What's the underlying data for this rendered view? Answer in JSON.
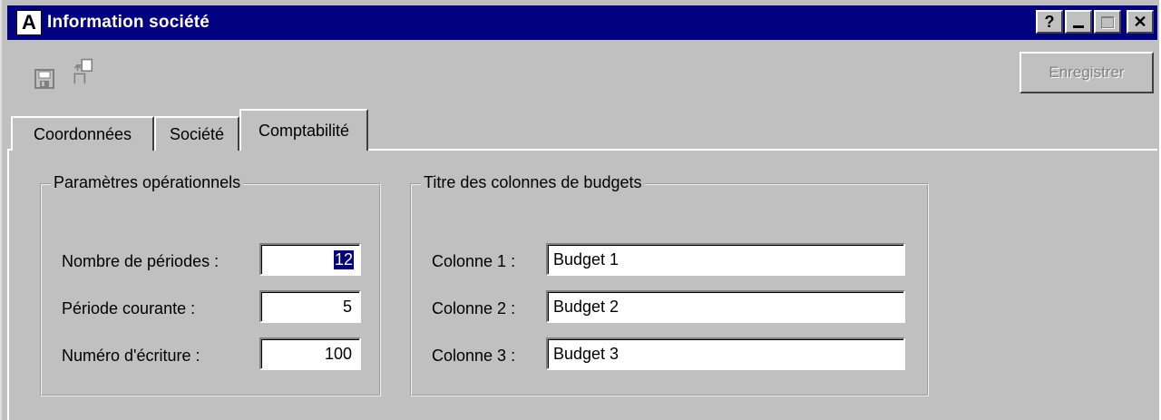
{
  "window": {
    "title": "Information société",
    "app_icon_letter": "A",
    "caption_buttons": [
      "?",
      "_",
      "□",
      "✕"
    ]
  },
  "toolbar": {
    "save_icon": "save-icon",
    "copy_icon": "copy-icon",
    "save_button_label": "Enregistrer"
  },
  "tabs": [
    {
      "label": "Coordonnées"
    },
    {
      "label": "Société"
    },
    {
      "label": "Comptabilité"
    }
  ],
  "operational": {
    "title": "Paramètres opérationnels",
    "fields": [
      {
        "label": "Nombre de périodes :",
        "value": "12"
      },
      {
        "label": "Période courante :",
        "value": "5"
      },
      {
        "label": "Numéro d'écriture :",
        "value": "100"
      }
    ]
  },
  "budgets": {
    "title": "Titre des colonnes de budgets",
    "fields": [
      {
        "label": "Colonne 1 :",
        "value": "Budget 1"
      },
      {
        "label": "Colonne 2 :",
        "value": "Budget 2"
      },
      {
        "label": "Colonne 3 :",
        "value": "Budget 3"
      }
    ]
  }
}
